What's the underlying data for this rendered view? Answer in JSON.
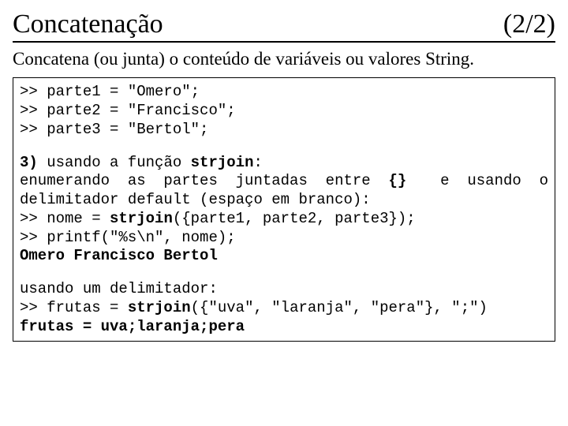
{
  "header": {
    "title": "Concatenação",
    "page": "(2/2)"
  },
  "subtitle": "Concatena (ou junta) o conteúdo de variáveis ou valores String.",
  "code": {
    "l1": ">> parte1 = \"Omero\";",
    "l2": ">> parte2 = \"Francisco\";",
    "l3": ">> parte3 = \"Bertol\";",
    "l4a": "3)",
    "l4b": " usando a função ",
    "l4c": "strjoin",
    "l4d": ":",
    "l5left": "enumerando  as  partes  juntadas  entre  ",
    "l5mid": "{}",
    "l5right": "  e  usando  o",
    "l6": "delimitador default (espaço em branco):",
    "l7a": ">> nome = ",
    "l7b": "strjoin",
    "l7c": "({parte1, parte2, parte3});",
    "l8": ">> printf(\"%s\\n\", nome);",
    "l9": "Omero Francisco Bertol",
    "l10": "usando um delimitador:",
    "l11a": ">> frutas = ",
    "l11b": "strjoin",
    "l11c": "({\"uva\", \"laranja\", \"pera\"}, \";\")",
    "l12": "frutas = uva;laranja;pera"
  }
}
